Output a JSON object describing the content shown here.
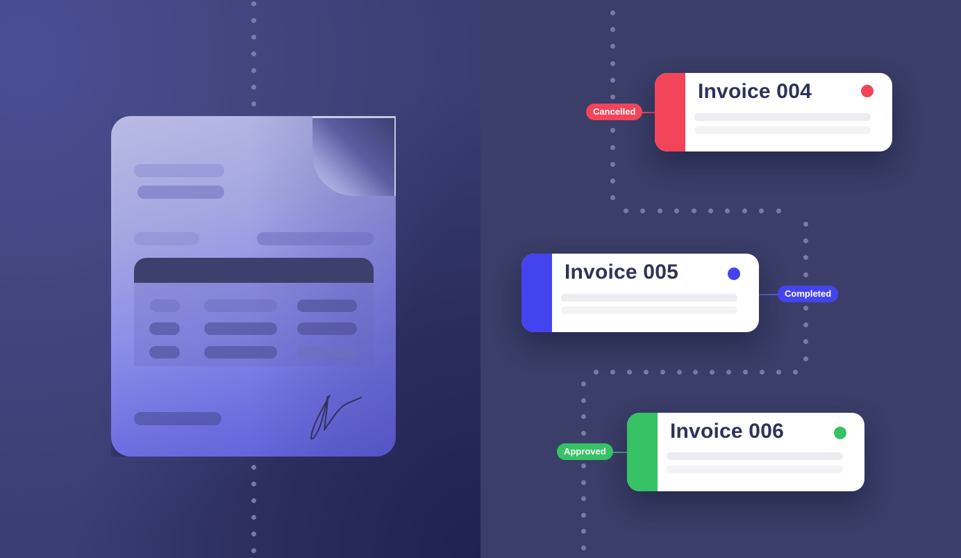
{
  "invoices": [
    {
      "title": "Invoice 004",
      "status": "Cancelled",
      "color": "#f2455a"
    },
    {
      "title": "Invoice 005",
      "status": "Completed",
      "color": "#4444ee"
    },
    {
      "title": "Invoice 006",
      "status": "Approved",
      "color": "#36c265"
    }
  ],
  "document_icon": {
    "semantic": "invoice-document-icon",
    "signature": "signature-icon"
  }
}
